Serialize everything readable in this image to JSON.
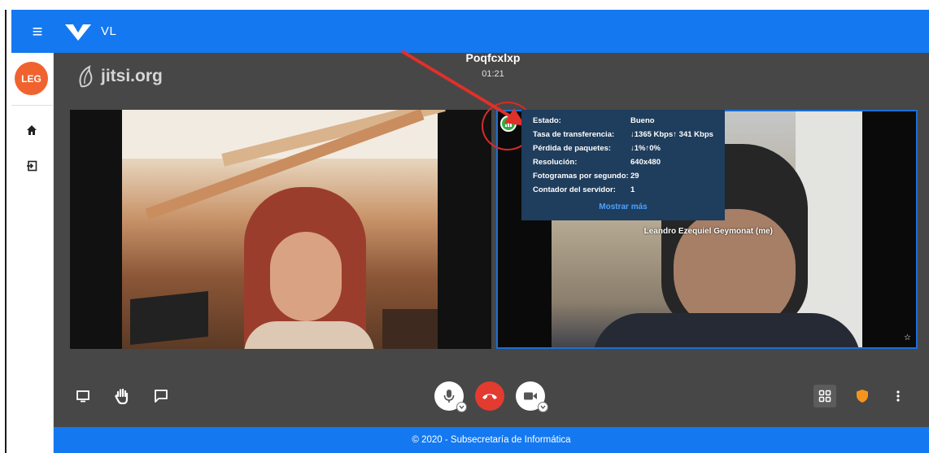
{
  "app": {
    "title": "VL",
    "avatar_initials": "LEG"
  },
  "sidebar": {
    "items": [
      {
        "icon": "home-icon"
      },
      {
        "icon": "logout-icon"
      }
    ]
  },
  "meeting": {
    "brand": "jitsi.org",
    "room_name": "Poqfcxlxp",
    "elapsed": "01:21",
    "remote_participant_name": "Leandro Ezequiel Geymonat (me)"
  },
  "connection_stats": {
    "rows": [
      {
        "label": "Estado:",
        "value": "Bueno"
      },
      {
        "label": "Tasa de transferencia:",
        "value": "↓1365 Kbps↑ 341 Kbps"
      },
      {
        "label": "Pérdida de paquetes:",
        "value": "↓1%↑0%"
      },
      {
        "label": "Resolución:",
        "value": "640x480"
      },
      {
        "label": "Fotogramas por segundo:",
        "value": "29"
      },
      {
        "label": "Contador del servidor:",
        "value": "1"
      }
    ],
    "show_more": "Mostrar más",
    "quality_color": "#2eb043"
  },
  "toolbar": {
    "left": [
      "screen-share-icon",
      "raise-hand-icon",
      "chat-icon"
    ],
    "center": [
      "microphone-icon",
      "hangup-icon",
      "camera-icon"
    ],
    "right": [
      "tile-view-icon",
      "security-shield-icon",
      "more-options-icon"
    ]
  },
  "footer": {
    "text": "© 2020 - Subsecretaría de Informática"
  },
  "colors": {
    "brand_blue": "#1478f0",
    "meeting_bg": "#474747",
    "hangup_red": "#e33b30",
    "annotation_red": "#d92a2a"
  }
}
